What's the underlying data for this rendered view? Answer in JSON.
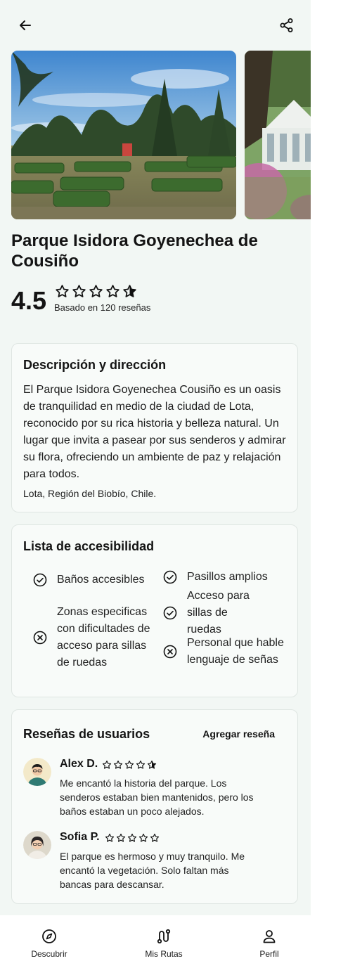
{
  "header": {
    "back_icon": "arrow-left-icon",
    "share_icon": "share-icon"
  },
  "gallery": {
    "photos": [
      "garden-hedge-maze-photo",
      "gazebo-flowers-photo"
    ]
  },
  "place": {
    "title": "Parque Isidora Goyenechea de Cousiño",
    "rating": "4.5",
    "rating_stars": 4.5,
    "rating_caption": "Basado en 120 reseñas"
  },
  "description": {
    "heading": "Descripción y dirección",
    "body": "El Parque Isidora Goyenechea Cousiño es un oasis de tranquilidad en medio de la ciudad de Lota, reconocido por su rica historia y belleza natural. Un lugar que invita a pasear por sus senderos y admirar su flora, ofreciendo un ambiente de paz y relajación para todos.",
    "address": "Lota, Región del Biobío, Chile."
  },
  "accessibility": {
    "heading": "Lista de accesibilidad",
    "items": [
      {
        "label": "Baños accesibles",
        "status": "check-circle-icon"
      },
      {
        "label": "Pasillos amplios",
        "status": "check-circle-icon"
      },
      {
        "label": "Acceso para sillas de ruedas",
        "status": "check-circle-icon"
      },
      {
        "label": "Zonas especificas con dificultades de acceso para sillas de ruedas",
        "status": "x-circle-icon"
      },
      {
        "label": "Personal que hable lenguaje de señas",
        "status": "x-circle-icon"
      }
    ]
  },
  "reviews": {
    "heading": "Reseñas de usuarios",
    "add_label": "Agregar reseña",
    "items": [
      {
        "name": "Alex D.",
        "stars": 4.5,
        "text": "Me encantó la historia del parque. Los senderos estaban bien mantenidos, pero los baños estaban un poco alejados."
      },
      {
        "name": "Sofia P.",
        "stars": 5,
        "text": "El parque es hermoso y muy tranquilo. Me encantó la vegetación. Solo faltan más bancas para descansar."
      }
    ]
  },
  "nav": {
    "items": [
      {
        "label": "Descubrir",
        "icon": "compass-icon"
      },
      {
        "label": "Mis Rutas",
        "icon": "route-icon"
      },
      {
        "label": "Perfil",
        "icon": "user-icon"
      }
    ]
  },
  "colors": {
    "screen_bg": "#f2f7f4",
    "card_bg": "#f8fbf9",
    "text": "#141414"
  }
}
